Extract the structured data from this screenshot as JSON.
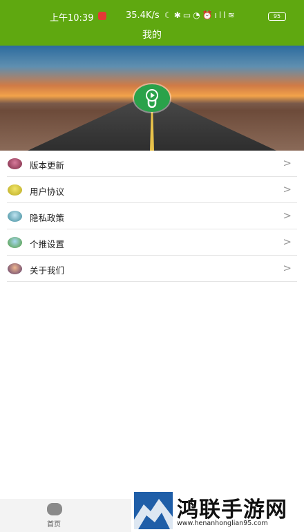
{
  "status_bar": {
    "time": "上午10:39",
    "speed": "35.4K/s",
    "battery": "95"
  },
  "header": {
    "title": "我的"
  },
  "menu": {
    "items": [
      {
        "label": "版本更新",
        "icon": "version-update-icon",
        "arrow": ">"
      },
      {
        "label": "用户协议",
        "icon": "user-agreement-icon",
        "arrow": ">"
      },
      {
        "label": "隐私政策",
        "icon": "privacy-policy-icon",
        "arrow": ">"
      },
      {
        "label": "个推设置",
        "icon": "push-settings-icon",
        "arrow": ">"
      },
      {
        "label": "关于我们",
        "icon": "about-us-icon",
        "arrow": ">"
      }
    ]
  },
  "bottom_nav": {
    "home_label": "首页"
  },
  "watermark": {
    "title": "鸿联手游网",
    "url": "www.henanhonglian95.com"
  },
  "colors": {
    "accent": "#5fa810",
    "logo": "#2aa24a"
  }
}
